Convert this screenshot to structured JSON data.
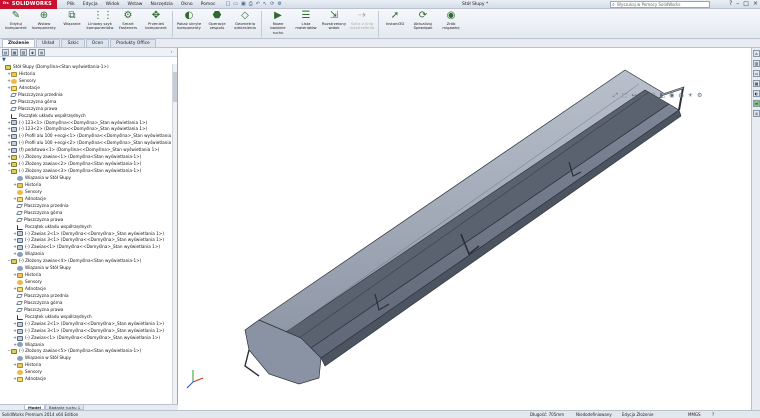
{
  "app": {
    "logo_text": "SOLIDWORKS",
    "document_title": "Stół Słupy *",
    "help_search_placeholder": "Wyszukaj w Pomocy SolidWorks"
  },
  "menu": [
    "Plik",
    "Edycja",
    "Widok",
    "Wstaw",
    "Narzędzia",
    "Okno",
    "Pomoc"
  ],
  "toolbar": [
    {
      "label": "Edytuj\nkomponent",
      "icon": "edit-component-icon",
      "glyph": "✎",
      "name": "edit-component"
    },
    {
      "label": "Wstaw\nkomponenty",
      "icon": "insert-components-icon",
      "glyph": "⊕",
      "name": "insert-components"
    },
    {
      "label": "Wiązanie",
      "icon": "mate-icon",
      "glyph": "⧉",
      "name": "mate"
    },
    {
      "label": "Liniowy szyk\nkomponentów",
      "icon": "linear-pattern-icon",
      "glyph": "⋮⋮",
      "name": "linear-pattern"
    },
    {
      "label": "Smart\nFasteners",
      "icon": "smart-fasteners-icon",
      "glyph": "⚙",
      "name": "smart-fasteners"
    },
    {
      "label": "Przenieś\nkomponent",
      "icon": "move-component-icon",
      "glyph": "✥",
      "name": "move-component"
    },
    {
      "label": "Pokaż ukryte\nkomponenty",
      "icon": "show-hidden-icon",
      "glyph": "◐",
      "name": "show-hidden"
    },
    {
      "label": "Operacje\nzespołu",
      "icon": "assembly-features-icon",
      "glyph": "⬣",
      "name": "assembly-features"
    },
    {
      "label": "Geometria\nodniesienia",
      "icon": "reference-geometry-icon",
      "glyph": "◇",
      "name": "reference-geometry"
    },
    {
      "label": "Nowe\nbadanie\nruchu",
      "icon": "motion-study-icon",
      "glyph": "▶",
      "name": "motion-study"
    },
    {
      "label": "Lista\nmateriałów",
      "icon": "bom-icon",
      "glyph": "☰",
      "name": "bom"
    },
    {
      "label": "Rozstrzelony\nwidok",
      "icon": "exploded-view-icon",
      "glyph": "⇲",
      "name": "exploded-view"
    },
    {
      "label": "Szkic z linią\nrozstrzelenia",
      "icon": "explode-line-sketch-icon",
      "glyph": "⇢",
      "name": "explode-line-sketch",
      "disabled": true
    },
    {
      "label": "Instant3D",
      "icon": "instant3d-icon",
      "glyph": "➚",
      "name": "instant3d"
    },
    {
      "label": "Aktualizuj\nSpeedpak",
      "icon": "speedpak-icon",
      "glyph": "⟳",
      "name": "speedpak"
    },
    {
      "label": "Zrób\nmigawkę",
      "icon": "snapshot-icon",
      "glyph": "◉",
      "name": "snapshot"
    }
  ],
  "tabs": [
    "Złożenie",
    "Układ",
    "Szkic",
    "Ocen",
    "Produkty Office"
  ],
  "tree": [
    {
      "t": "Stół Słupy  (Domyślna<Stan wyświetlania-1>)",
      "lvl": 0,
      "ic": "asm",
      "tg": ""
    },
    {
      "t": "Historia",
      "lvl": 1,
      "ic": "folder",
      "tg": "+"
    },
    {
      "t": "Sensory",
      "lvl": 1,
      "ic": "sensor",
      "tg": "+"
    },
    {
      "t": "Adnotacje",
      "lvl": 1,
      "ic": "annot",
      "tg": "+"
    },
    {
      "t": "Płaszczyzna przednia",
      "lvl": 1,
      "ic": "plane",
      "tg": ""
    },
    {
      "t": "Płaszczyzna górna",
      "lvl": 1,
      "ic": "plane",
      "tg": ""
    },
    {
      "t": "Płaszczyzna prawa",
      "lvl": 1,
      "ic": "plane",
      "tg": ""
    },
    {
      "t": "Początek układu współrzędnych",
      "lvl": 1,
      "ic": "origin",
      "tg": ""
    },
    {
      "t": "(-) 123<1> (Domyślna<<Domyślna>_Stan wyświetlania 1>)",
      "lvl": 1,
      "ic": "part",
      "tg": "+"
    },
    {
      "t": "(-) 123<2> (Domyślna<<Domyślna>_Stan wyświetlania 1>)",
      "lvl": 1,
      "ic": "part",
      "tg": "+"
    },
    {
      "t": "(-) Profil alu 100 +ecgi<1> (Domyślna<<Domyślna>_Stan wyświetlania 1>)",
      "lvl": 1,
      "ic": "part",
      "tg": "+"
    },
    {
      "t": "(-) Profil alu 100 +ecgi<2> (Domyślna<<Domyślna>_Stan wyświetlania 1>)",
      "lvl": 1,
      "ic": "part",
      "tg": "+"
    },
    {
      "t": "(f) podstawa<1> (Domyślna<<Domyślna>_Stan wyświetlania 1>)",
      "lvl": 1,
      "ic": "part",
      "tg": "+"
    },
    {
      "t": "(-) Złożony zawias<1> (Domyślna<Stan wyświetlania-1>)",
      "lvl": 1,
      "ic": "asm",
      "tg": "+"
    },
    {
      "t": "(-) Złożony zawias<2> (Domyślna<Stan wyświetlania-1>)",
      "lvl": 1,
      "ic": "asm",
      "tg": "+"
    },
    {
      "t": "(-) Złożony zawias<3> (Domyślna<Stan wyświetlania-1>)",
      "lvl": 1,
      "ic": "asm",
      "tg": "−"
    },
    {
      "t": "Wiązania w Stół Słupy",
      "lvl": 2,
      "ic": "mate",
      "tg": ""
    },
    {
      "t": "Historia",
      "lvl": 2,
      "ic": "folder",
      "tg": "+"
    },
    {
      "t": "Sensory",
      "lvl": 2,
      "ic": "sensor",
      "tg": ""
    },
    {
      "t": "Adnotacje",
      "lvl": 2,
      "ic": "annot",
      "tg": "+"
    },
    {
      "t": "Płaszczyzna przednia",
      "lvl": 2,
      "ic": "plane",
      "tg": ""
    },
    {
      "t": "Płaszczyzna górna",
      "lvl": 2,
      "ic": "plane",
      "tg": ""
    },
    {
      "t": "Płaszczyzna prawa",
      "lvl": 2,
      "ic": "plane",
      "tg": ""
    },
    {
      "t": "Początek układu współrzędnych",
      "lvl": 2,
      "ic": "origin",
      "tg": ""
    },
    {
      "t": "(-) Zawias 2<1> (Domyślna<<Domyślna>_Stan wyświetlania 1>)",
      "lvl": 2,
      "ic": "part",
      "tg": "+"
    },
    {
      "t": "(-) Zawias 3<1> (Domyślna<<Domyślna>_Stan wyświetlania 1>)",
      "lvl": 2,
      "ic": "part",
      "tg": "+"
    },
    {
      "t": "(-) Zawias<1> (Domyślna<<Domyślna>_Stan wyświetlania 1>)",
      "lvl": 2,
      "ic": "part",
      "tg": "+"
    },
    {
      "t": "Wiązania",
      "lvl": 2,
      "ic": "mate",
      "tg": "+"
    },
    {
      "t": "(-) Złożony zawias<4> (Domyślna<Stan wyświetlania-1>)",
      "lvl": 1,
      "ic": "asm",
      "tg": "−"
    },
    {
      "t": "Wiązania w Stół Słupy",
      "lvl": 2,
      "ic": "mate",
      "tg": ""
    },
    {
      "t": "Historia",
      "lvl": 2,
      "ic": "folder",
      "tg": "+"
    },
    {
      "t": "Sensory",
      "lvl": 2,
      "ic": "sensor",
      "tg": ""
    },
    {
      "t": "Adnotacje",
      "lvl": 2,
      "ic": "annot",
      "tg": "+"
    },
    {
      "t": "Płaszczyzna przednia",
      "lvl": 2,
      "ic": "plane",
      "tg": ""
    },
    {
      "t": "Płaszczyzna górna",
      "lvl": 2,
      "ic": "plane",
      "tg": ""
    },
    {
      "t": "Płaszczyzna prawa",
      "lvl": 2,
      "ic": "plane",
      "tg": ""
    },
    {
      "t": "Początek układu współrzędnych",
      "lvl": 2,
      "ic": "origin",
      "tg": ""
    },
    {
      "t": "(-) Zawias 2<1> (Domyślna<<Domyślna>_Stan wyświetlania 1>)",
      "lvl": 2,
      "ic": "part",
      "tg": "+"
    },
    {
      "t": "(-) Zawias 3<1> (Domyślna<<Domyślna>_Stan wyświetlania 1>)",
      "lvl": 2,
      "ic": "part",
      "tg": "+"
    },
    {
      "t": "(-) Zawias<1> (Domyślna<<Domyślna>_Stan wyświetlania 1>)",
      "lvl": 2,
      "ic": "part",
      "tg": "+"
    },
    {
      "t": "Wiązania",
      "lvl": 2,
      "ic": "mate",
      "tg": "+"
    },
    {
      "t": "(-) Złożony zawias<5> (Domyślna<Stan wyświetlania-1>)",
      "lvl": 1,
      "ic": "asm",
      "tg": "−"
    },
    {
      "t": "Wiązania w Stół Słupy",
      "lvl": 2,
      "ic": "mate",
      "tg": ""
    },
    {
      "t": "Historia",
      "lvl": 2,
      "ic": "folder",
      "tg": "+"
    },
    {
      "t": "Sensory",
      "lvl": 2,
      "ic": "sensor",
      "tg": ""
    },
    {
      "t": "Adnotacje",
      "lvl": 2,
      "ic": "annot",
      "tg": "+"
    }
  ],
  "bottom_tabs": [
    "Model",
    "Badanie ruchu 1"
  ],
  "status": {
    "edition": "SolidWorks Premium 2014 x64 Edition",
    "length": "Długość: 705mm",
    "defined": "Niedodefiniowany",
    "editing": "Edycja Złożenie",
    "units": "MMGS",
    "help": "?"
  },
  "hud_icons": [
    "zoom-fit-icon",
    "zoom-area-icon",
    "previous-view-icon",
    "section-view-icon",
    "view-orientation-icon",
    "display-style-icon",
    "hide-show-icon",
    "appearance-icon",
    "scene-icon",
    "view-settings-icon"
  ],
  "colors": {
    "accent": "#c8102e",
    "part_face": "#9aa3b3",
    "part_edge": "#2b2f36"
  }
}
